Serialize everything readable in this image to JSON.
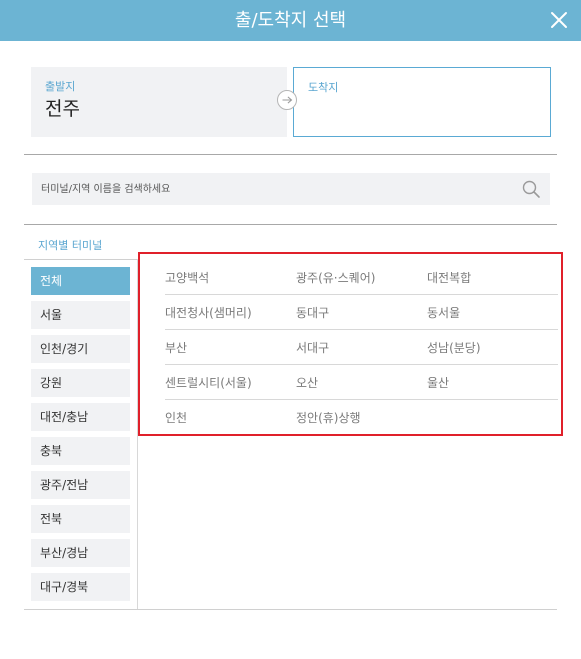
{
  "header": {
    "title": "출/도착지 선택",
    "close_icon": "close-icon"
  },
  "departure": {
    "label": "출발지",
    "value": "전주"
  },
  "arrival": {
    "label": "도착지",
    "value": ""
  },
  "search": {
    "placeholder": "터미널/지역 이름을 검색하세요",
    "icon": "search-icon"
  },
  "region_section": {
    "title": "지역별 터미널"
  },
  "sidebar": {
    "items": [
      {
        "label": "전체",
        "active": true
      },
      {
        "label": "서울"
      },
      {
        "label": "인천/경기"
      },
      {
        "label": "강원"
      },
      {
        "label": "대전/충남"
      },
      {
        "label": "충북"
      },
      {
        "label": "광주/전남"
      },
      {
        "label": "전북"
      },
      {
        "label": "부산/경남"
      },
      {
        "label": "대구/경북"
      }
    ]
  },
  "terminals": {
    "rows": [
      [
        "고양백석",
        "광주(유·스퀘어)",
        "대전복합"
      ],
      [
        "대전청사(샘머리)",
        "동대구",
        "동서울"
      ],
      [
        "부산",
        "서대구",
        "성남(분당)"
      ],
      [
        "센트럴시티(서울)",
        "오산",
        "울산"
      ],
      [
        "인천",
        "정안(휴)상행"
      ]
    ]
  },
  "colors": {
    "accent": "#6cb4d3",
    "highlight": "#e0202a",
    "label_blue": "#5aa6d0"
  }
}
